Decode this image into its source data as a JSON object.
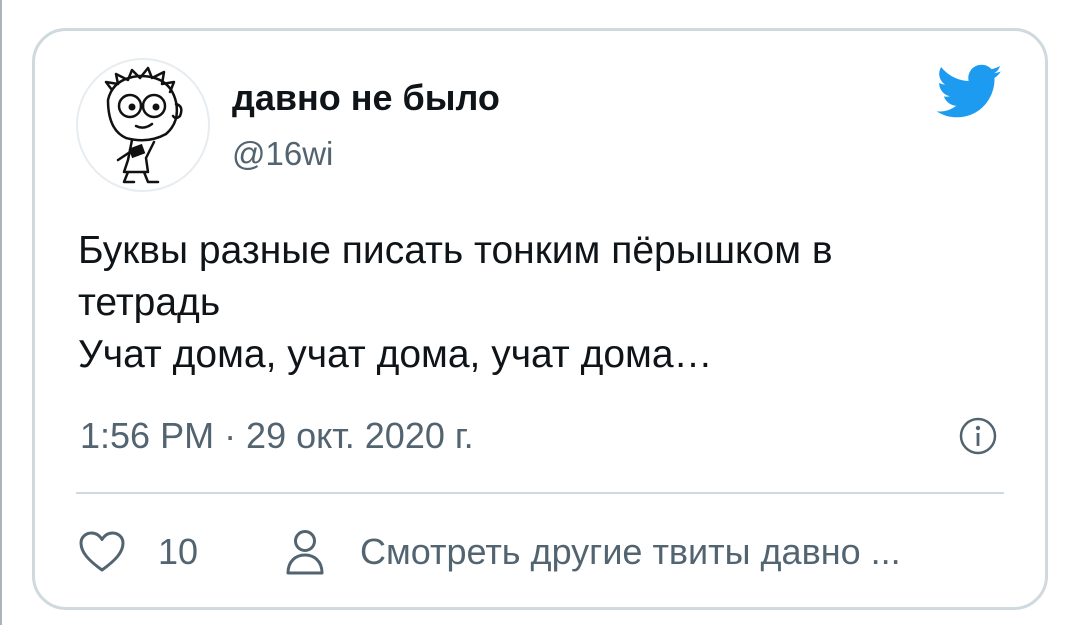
{
  "tweet": {
    "author_name": "давно не было",
    "author_handle": "@16wi",
    "text_lines": [
      "Буквы разные писать тонким пёрышком в",
      "тетрадь",
      "Учат дома, учат дома, учат дома…"
    ],
    "timestamp": "1:56 PM · 29 окт. 2020 г.",
    "like_count": "10",
    "more_tweets_label": "Смотреть другие твиты давно ..."
  },
  "icons": {
    "brand": "twitter-bird-icon",
    "info": "info-icon",
    "like": "heart-icon",
    "profile": "person-icon"
  },
  "colors": {
    "twitter_blue": "#1d9bf0",
    "text_primary": "#0f1419",
    "text_secondary": "#536471",
    "border": "#cfd9de"
  }
}
